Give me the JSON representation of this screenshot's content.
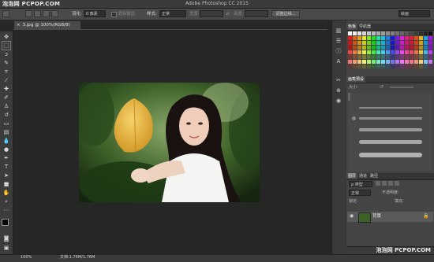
{
  "app": {
    "title": "Adobe Photoshop CC 2015",
    "watermark_top": "泡泡网 PCPOP.COM",
    "watermark_bottom": "泡泡网 PCPOP.COM"
  },
  "options_bar": {
    "feather_label": "羽化:",
    "feather_value": "0 像素",
    "antialias_label": "消除锯齿",
    "style_label": "样式:",
    "style_value": "正常",
    "width_label": "宽度:",
    "height_label": "高度:",
    "refine_edge_label": "调整边缘...",
    "workspace_value": "绘画"
  },
  "document": {
    "tab_label": "3.jpg @ 100%(RGB/8)",
    "zoom": "100%",
    "doc_size": "文档:1.76M/1.76M"
  },
  "panels": {
    "color_tabs": [
      "色板",
      "导航器"
    ],
    "brush_tabs": [
      "画笔预设"
    ],
    "size_label": "大小:",
    "layers_tabs": [
      "图层",
      "通道",
      "路径"
    ],
    "kind_label": "ρ 类型",
    "blend_mode": "正常",
    "opacity_label": "不透明度:",
    "lock_label": "锁定:",
    "fill_label": "填充:",
    "layer_name": "背景"
  },
  "colors": {
    "accent": "#2b66b8",
    "app_bg": "#262626",
    "panel_bg": "#444444"
  }
}
